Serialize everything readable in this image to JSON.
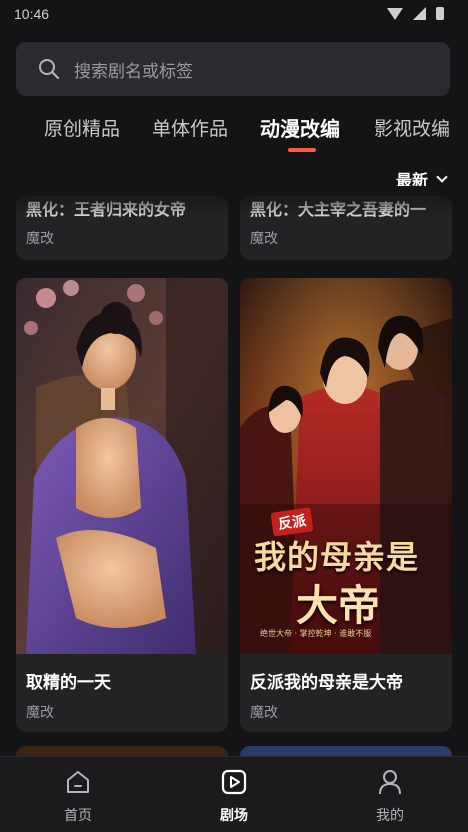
{
  "status_bar": {
    "time": "10:46"
  },
  "search": {
    "placeholder": "搜索剧名或标签"
  },
  "tabs": [
    {
      "label": "原创精品"
    },
    {
      "label": "单体作品"
    },
    {
      "label": "动漫改编",
      "active": true
    },
    {
      "label": "影视改编"
    }
  ],
  "sort": {
    "label": "最新"
  },
  "cards": [
    {
      "title": "黑化：王者归来的女帝",
      "tag": "魔改"
    },
    {
      "title": "黑化：大主宰之吾妻的一",
      "tag": "魔改"
    },
    {
      "title": "取精的一天",
      "tag": "魔改"
    },
    {
      "title": "反派我的母亲是大帝",
      "tag": "魔改"
    }
  ],
  "poster2": {
    "badge": "反派",
    "headline_line1": "我的母亲是",
    "headline_line2": "大帝",
    "caption": "绝世大帝 · 掌控乾坤 · 谁敢不服"
  },
  "bottom_nav": [
    {
      "label": "首页",
      "icon": "home-icon"
    },
    {
      "label": "剧场",
      "icon": "play-icon",
      "active": true
    },
    {
      "label": "我的",
      "icon": "user-icon"
    }
  ],
  "colors": {
    "accent": "#ff5a3c",
    "background": "#141416",
    "card": "#232326"
  }
}
